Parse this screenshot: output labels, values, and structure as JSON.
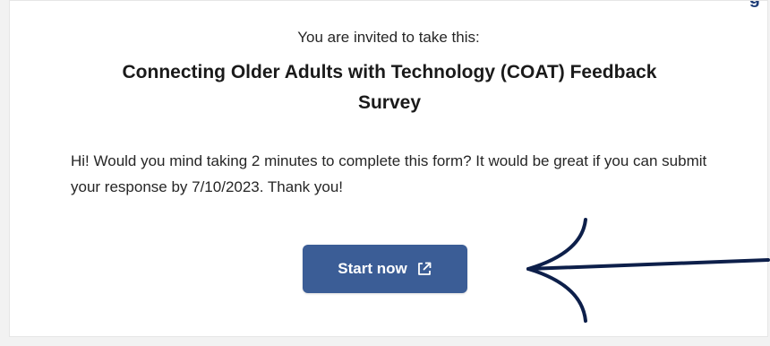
{
  "invite_text": "You are invited to take this:",
  "survey_title": "Connecting Older Adults with Technology (COAT) Feedback Survey",
  "message": "Hi! Would you mind taking 2 minutes to complete this form? It would be great if you can submit your response by 7/10/2023. Thank you!",
  "start_button": {
    "label": "Start now",
    "icon": "external-link-icon"
  },
  "annotation": {
    "icon": "arrow-pointer-icon"
  },
  "colors": {
    "button": "#3b5d96",
    "arrow": "#0d1f4a",
    "heading_clip": "#1f3e78"
  }
}
